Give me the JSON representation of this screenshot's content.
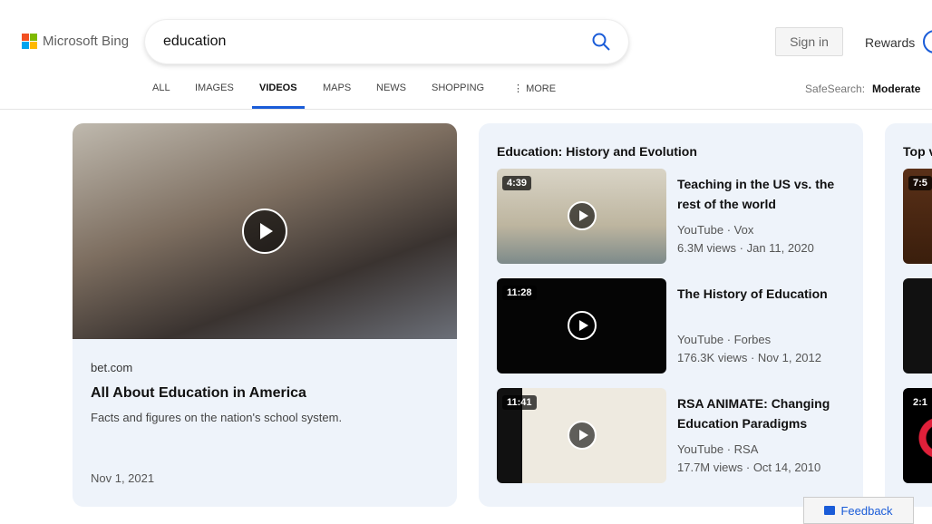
{
  "header": {
    "brand": "Microsoft Bing",
    "query": "education",
    "sign_in": "Sign in",
    "rewards": "Rewards"
  },
  "nav": {
    "tabs": [
      "ALL",
      "IMAGES",
      "VIDEOS",
      "MAPS",
      "NEWS",
      "SHOPPING",
      "MORE"
    ],
    "active": "VIDEOS",
    "safesearch_label": "SafeSearch:",
    "safesearch_value": "Moderate"
  },
  "hero": {
    "source": "bet.com",
    "title": "All About Education in America",
    "description": "Facts and figures on the nation's school system.",
    "date": "Nov 1, 2021"
  },
  "section": {
    "title": "Education: History and Evolution",
    "videos": [
      {
        "duration": "4:39",
        "title": "Teaching in the US vs. the rest of the world",
        "platform": "YouTube",
        "channel": "Vox",
        "views": "6.3M views",
        "date": "Jan 11, 2020"
      },
      {
        "duration": "11:28",
        "title": "The History of Education",
        "platform": "YouTube",
        "channel": "Forbes",
        "views": "176.3K views",
        "date": "Nov 1, 2012"
      },
      {
        "duration": "11:41",
        "title": "RSA ANIMATE: Changing Education Paradigms",
        "platform": "YouTube",
        "channel": "RSA",
        "views": "17.7M views",
        "date": "Oct 14, 2010"
      }
    ]
  },
  "right_section": {
    "title": "Top v",
    "durations": [
      "7:5",
      "",
      "2:1"
    ]
  },
  "feedback": "Feedback",
  "colors": {
    "accent": "#1a5cd8",
    "card_bg": "#eef3fa"
  }
}
